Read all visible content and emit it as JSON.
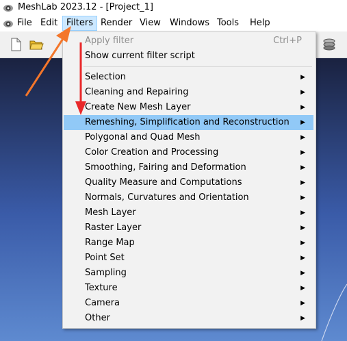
{
  "window": {
    "title": "MeshLab 2023.12 - [Project_1]",
    "app_icon": "meshlab-eye-icon"
  },
  "menubar": {
    "items": [
      {
        "label": "File"
      },
      {
        "label": "Edit"
      },
      {
        "label": "Filters"
      },
      {
        "label": "Render"
      },
      {
        "label": "View"
      },
      {
        "label": "Windows"
      },
      {
        "label": "Tools"
      },
      {
        "label": "Help"
      }
    ],
    "active": "Filters"
  },
  "toolbar": {
    "icons": [
      "new-file-icon",
      "open-folder-icon",
      "mesh-layers-icon"
    ]
  },
  "filters_menu": {
    "top": [
      {
        "label": "Apply filter",
        "shortcut": "Ctrl+P",
        "disabled": true
      },
      {
        "label": "Show current filter script"
      }
    ],
    "items": [
      {
        "label": "Selection"
      },
      {
        "label": "Cleaning and Repairing"
      },
      {
        "label": "Create New Mesh Layer"
      },
      {
        "label": "Remeshing, Simplification and Reconstruction",
        "highlighted": true
      },
      {
        "label": "Polygonal and Quad Mesh"
      },
      {
        "label": "Color Creation and Processing"
      },
      {
        "label": "Smoothing, Fairing and Deformation"
      },
      {
        "label": "Quality Measure and Computations"
      },
      {
        "label": "Normals, Curvatures and Orientation"
      },
      {
        "label": "Mesh Layer"
      },
      {
        "label": "Raster Layer"
      },
      {
        "label": "Range Map"
      },
      {
        "label": "Point Set"
      },
      {
        "label": "Sampling"
      },
      {
        "label": "Texture"
      },
      {
        "label": "Camera"
      },
      {
        "label": "Other"
      }
    ]
  },
  "annotation": {
    "color": "#f4762a",
    "arrow_color": "#e8282a"
  }
}
